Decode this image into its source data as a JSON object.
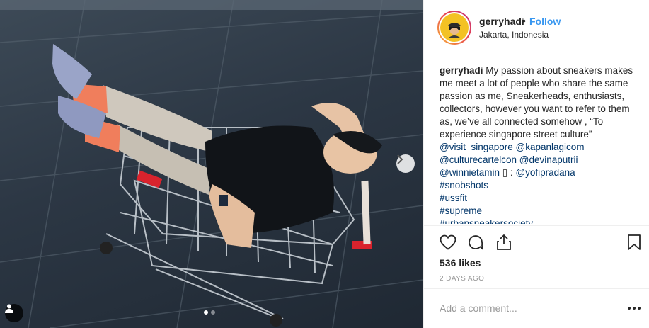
{
  "post": {
    "username": "gerryhadi",
    "bullet": "•",
    "follow_label": "Follow",
    "location": "Jakarta, Indonesia",
    "caption": {
      "username": "gerryhadi",
      "text": " My passion about sneakers makes me meet a lot of people who share the same passion as me, Sneakerheads, enthusiasts, collectors, however you want to refer to them as, we’ve all connected somehow , “To experience singapore street culture” ",
      "links": [
        "@visit_singapore",
        "@kapanlagicom",
        "@culturecartelcon",
        "@devinaputrii",
        "@winnietamin",
        "@yofipradana",
        "#snobshots",
        "#ussfit",
        "#supreme",
        "#urbansneakersociety"
      ],
      "separators": [
        " ",
        "\n",
        " ",
        "\n",
        " ▯ : ",
        "\n",
        "\n",
        "\n",
        "\n",
        ""
      ]
    },
    "likes": "536 likes",
    "time": "2 DAYS AGO",
    "comment_placeholder": "Add a comment...",
    "carousel": {
      "total": 2,
      "active": 1
    },
    "icons": {
      "like": "heart-icon",
      "comment": "comment-icon",
      "share": "share-icon",
      "save": "bookmark-icon",
      "tag": "user-tag-icon",
      "next": "chevron-right-icon",
      "more": "more-options-icon"
    },
    "colors": {
      "follow": "#3897f0",
      "link": "#003569",
      "muted": "#999999"
    }
  }
}
